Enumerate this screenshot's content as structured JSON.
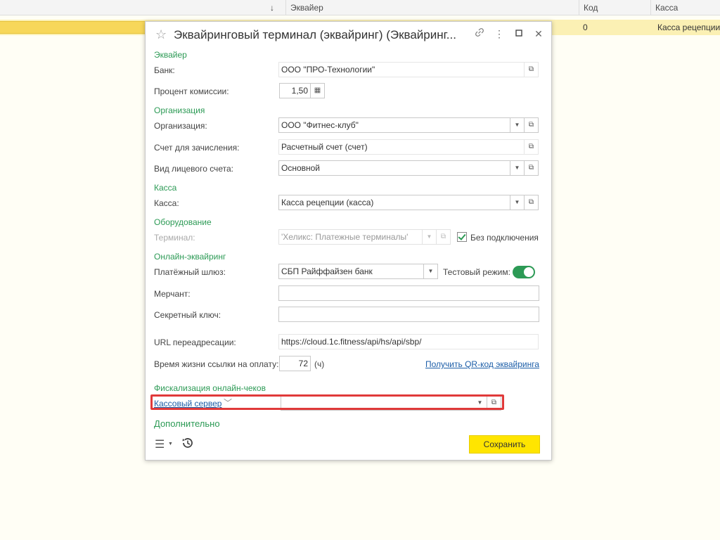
{
  "list": {
    "sort_arrow": "↓",
    "columns": [
      "Эквайер",
      "Код",
      "Касса"
    ],
    "row": {
      "code": "0",
      "kassa": "Касса рецепции"
    }
  },
  "dialog": {
    "title": "Эквайринговый терминал (эквайринг) (Эквайринг...",
    "sections": {
      "acquirer": "Эквайер",
      "org": "Организация",
      "kassa": "Касса",
      "equipment": "Оборудование",
      "online": "Онлайн-эквайринг",
      "fiscal": "Фискализация онлайн-чеков",
      "extra": "Дополнительно"
    },
    "fields": {
      "bank_label": "Банк:",
      "bank_value": "ООО \"ПРО-Технологии\"",
      "commission_label": "Процент комиссии:",
      "commission_value": "1,50",
      "org_label": "Организация:",
      "org_value": "ООО \"Фитнес-клуб\"",
      "account_label": "Счет для зачисления:",
      "account_value": "Расчетный счет (счет)",
      "personal_label": "Вид лицевого счета:",
      "personal_value": "Основной",
      "kassa_label": "Касса:",
      "kassa_value": "Касса рецепции (касса)",
      "terminal_label": "Терминал:",
      "terminal_value": "'Хеликс: Платежные терминалы'",
      "offline_label": "Без подключения",
      "gateway_label": "Платёжный шлюз:",
      "gateway_value": "СБП Райффайзен банк",
      "test_label": "Тестовый режим:",
      "merchant_label": "Мерчант:",
      "merchant_value": "",
      "secret_label": "Секретный ключ:",
      "secret_value": "",
      "url_label": "URL переадресации:",
      "url_value": "https://cloud.1c.fitness/api/hs/api/sbp/",
      "ttl_label": "Время жизни ссылки на оплату:",
      "ttl_value": "72",
      "ttl_unit": "(ч)",
      "qr_link": "Получить QR-код эквайринга",
      "cash_server_label": "Кассовый сервер",
      "cash_server_value": ""
    },
    "save_label": "Сохранить"
  },
  "colors": {
    "accent": "#2c9a55",
    "save": "#ffe500",
    "highlight": "#e03a3a",
    "link": "#1c5ea8"
  }
}
